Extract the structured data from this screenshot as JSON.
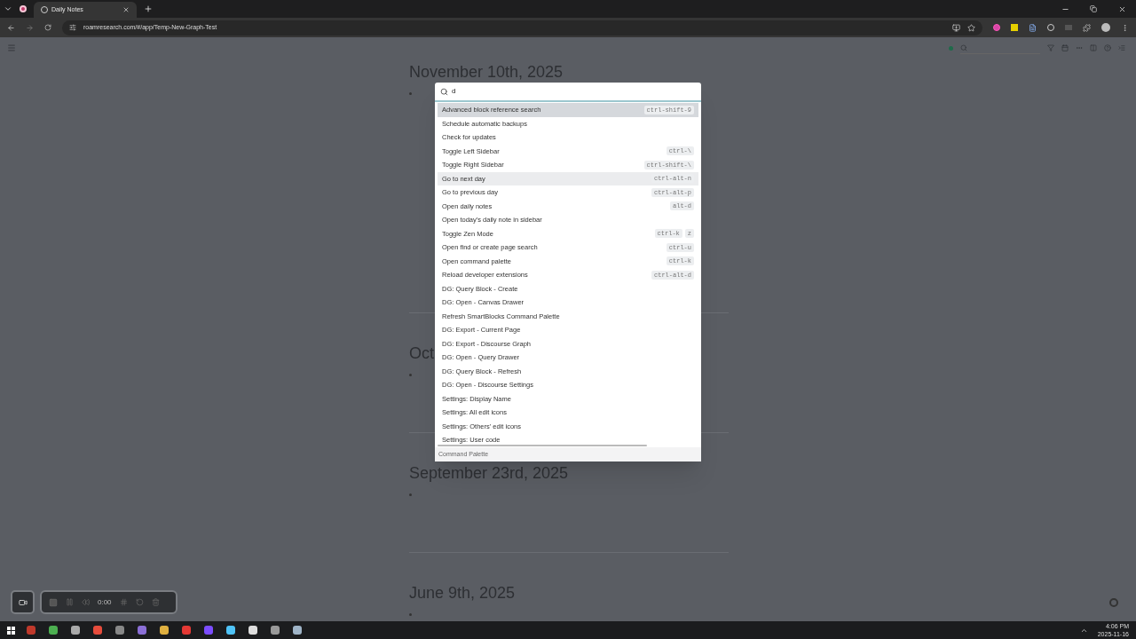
{
  "browser": {
    "tabs": [
      {
        "title": "Daily Notes",
        "selected": true
      }
    ],
    "url": "roamresearch.com/#/app/Temp-New-Graph-Test"
  },
  "pages": [
    {
      "title": "November 10th, 2025"
    },
    {
      "title": "Oct"
    },
    {
      "title": "September 23rd, 2025"
    },
    {
      "title": "June 9th, 2025"
    }
  ],
  "palette": {
    "query": "d",
    "footer": "Command Palette",
    "commands": [
      {
        "label": "Advanced block reference search",
        "shortcuts": [
          "ctrl-shift-9"
        ],
        "selected": true,
        "hovered": false
      },
      {
        "label": "Schedule automatic backups",
        "selected": false,
        "hovered": false
      },
      {
        "label": "Check for updates",
        "selected": false,
        "hovered": false
      },
      {
        "label": "Toggle Left Sidebar",
        "shortcuts": [
          "ctrl-\\"
        ],
        "selected": false,
        "hovered": false
      },
      {
        "label": "Toggle Right Sidebar",
        "shortcuts": [
          "ctrl-shift-\\"
        ],
        "selected": false,
        "hovered": false
      },
      {
        "label": "Go to next day",
        "shortcuts": [
          "ctrl-alt-n"
        ],
        "selected": false,
        "hovered": true
      },
      {
        "label": "Go to previous day",
        "shortcuts": [
          "ctrl-alt-p"
        ],
        "selected": false,
        "hovered": false
      },
      {
        "label": "Open daily notes",
        "shortcuts": [
          "alt-d"
        ],
        "selected": false,
        "hovered": false
      },
      {
        "label": "Open today's daily note in sidebar",
        "selected": false,
        "hovered": false
      },
      {
        "label": "Toggle Zen Mode",
        "shortcuts": [
          "ctrl-k",
          "z"
        ],
        "selected": false,
        "hovered": false
      },
      {
        "label": "Open find or create page search",
        "shortcuts": [
          "ctrl-u"
        ],
        "selected": false,
        "hovered": false
      },
      {
        "label": "Open command palette",
        "shortcuts": [
          "ctrl-k"
        ],
        "selected": false,
        "hovered": false
      },
      {
        "label": "Reload developer extensions",
        "shortcuts": [
          "ctrl-alt-d"
        ],
        "selected": false,
        "hovered": false
      },
      {
        "label": "DG: Query Block - Create",
        "selected": false,
        "hovered": false
      },
      {
        "label": "DG: Open - Canvas Drawer",
        "selected": false,
        "hovered": false
      },
      {
        "label": "Refresh SmartBlocks Command Palette",
        "selected": false,
        "hovered": false
      },
      {
        "label": "DG: Export - Current Page",
        "selected": false,
        "hovered": false
      },
      {
        "label": "DG: Export - Discourse Graph",
        "selected": false,
        "hovered": false
      },
      {
        "label": "DG: Open - Query Drawer",
        "selected": false,
        "hovered": false
      },
      {
        "label": "DG: Query Block - Refresh",
        "selected": false,
        "hovered": false
      },
      {
        "label": "DG: Open - Discourse Settings",
        "selected": false,
        "hovered": false
      },
      {
        "label": "Settings: Display Name",
        "selected": false,
        "hovered": false
      },
      {
        "label": "Settings: All edit icons",
        "selected": false,
        "hovered": false
      },
      {
        "label": "Settings: Others' edit icons",
        "selected": false,
        "hovered": false
      },
      {
        "label": "Settings: User code",
        "selected": false,
        "hovered": false
      }
    ]
  },
  "recorder": {
    "time": "0:00"
  },
  "taskbar": {
    "time": "4:06 PM",
    "date": "2025-11-16"
  }
}
